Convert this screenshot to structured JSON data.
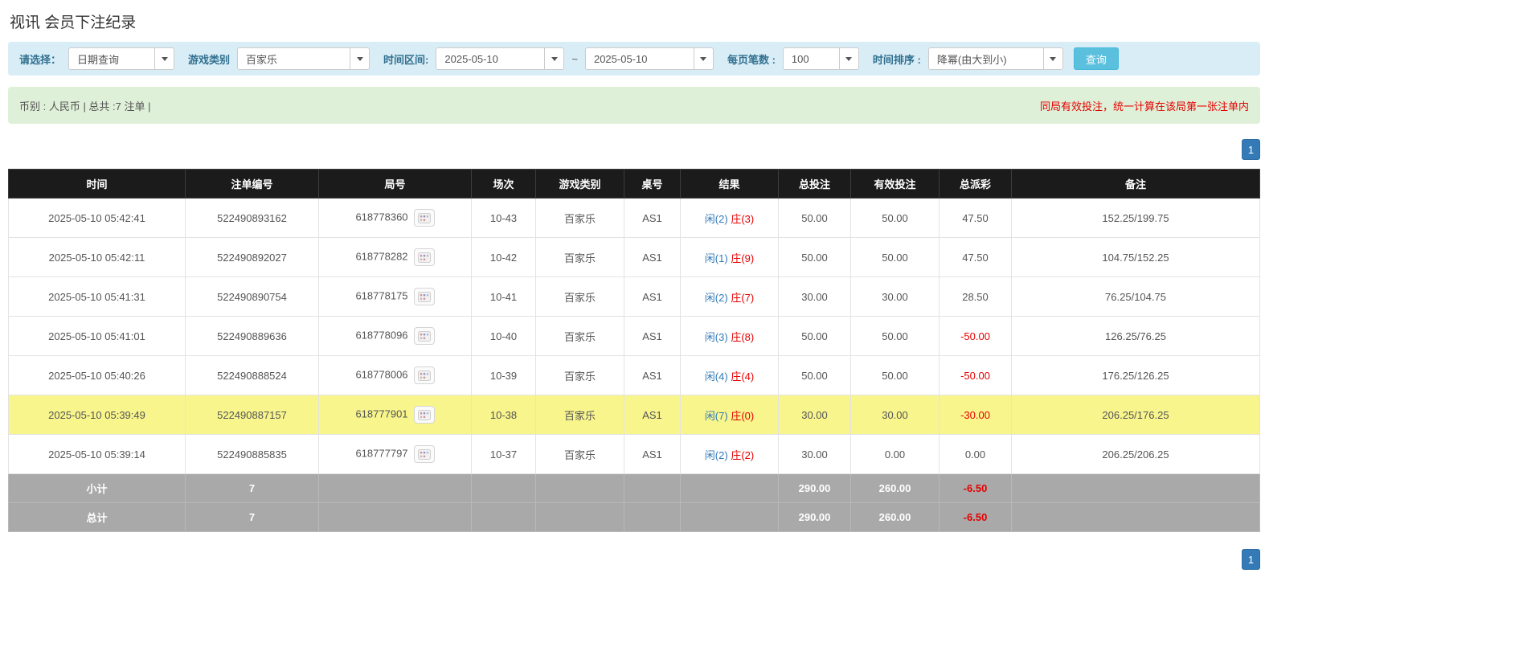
{
  "page": {
    "title": "视讯 会员下注纪录"
  },
  "filters": {
    "query_label": "请选择：",
    "query_value": "日期查询",
    "game_label": "游戏类别",
    "game_value": "百家乐",
    "range_label": "时间区间:",
    "date_from": "2025-05-10",
    "tilde": "~",
    "date_to": "2025-05-10",
    "page_size_label": "每页笔数 :",
    "page_size_value": "100",
    "sort_label": "时间排序 :",
    "sort_value": "降幂(由大到小)",
    "search_label": "查询"
  },
  "summary": {
    "left": "币别 : 人民币 | 总共 :7 注单 |",
    "notice": "同局有效投注，统一计算在该局第一张注单内"
  },
  "pagination": {
    "page": "1"
  },
  "table": {
    "columns": [
      "时间",
      "注单编号",
      "局号",
      "场次",
      "游戏类别",
      "桌号",
      "结果",
      "总投注",
      "有效投注",
      "总派彩",
      "备注"
    ],
    "rows": [
      {
        "time": "2025-05-10 05:42:41",
        "bet_no": "522490893162",
        "round_no": "618778360",
        "session": "10-43",
        "game": "百家乐",
        "table_no": "AS1",
        "player": "闲(2)",
        "banker": "庄(3)",
        "total_bet": "50.00",
        "valid_bet": "50.00",
        "payout": "47.50",
        "note": "152.25/199.75",
        "highlight": false
      },
      {
        "time": "2025-05-10 05:42:11",
        "bet_no": "522490892027",
        "round_no": "618778282",
        "session": "10-42",
        "game": "百家乐",
        "table_no": "AS1",
        "player": "闲(1)",
        "banker": "庄(9)",
        "total_bet": "50.00",
        "valid_bet": "50.00",
        "payout": "47.50",
        "note": "104.75/152.25",
        "highlight": false
      },
      {
        "time": "2025-05-10 05:41:31",
        "bet_no": "522490890754",
        "round_no": "618778175",
        "session": "10-41",
        "game": "百家乐",
        "table_no": "AS1",
        "player": "闲(2)",
        "banker": "庄(7)",
        "total_bet": "30.00",
        "valid_bet": "30.00",
        "payout": "28.50",
        "note": "76.25/104.75",
        "highlight": false
      },
      {
        "time": "2025-05-10 05:41:01",
        "bet_no": "522490889636",
        "round_no": "618778096",
        "session": "10-40",
        "game": "百家乐",
        "table_no": "AS1",
        "player": "闲(3)",
        "banker": "庄(8)",
        "total_bet": "50.00",
        "valid_bet": "50.00",
        "payout": "-50.00",
        "note": "126.25/76.25",
        "highlight": false
      },
      {
        "time": "2025-05-10 05:40:26",
        "bet_no": "522490888524",
        "round_no": "618778006",
        "session": "10-39",
        "game": "百家乐",
        "table_no": "AS1",
        "player": "闲(4)",
        "banker": "庄(4)",
        "total_bet": "50.00",
        "valid_bet": "50.00",
        "payout": "-50.00",
        "note": "176.25/126.25",
        "highlight": false
      },
      {
        "time": "2025-05-10 05:39:49",
        "bet_no": "522490887157",
        "round_no": "618777901",
        "session": "10-38",
        "game": "百家乐",
        "table_no": "AS1",
        "player": "闲(7)",
        "banker": "庄(0)",
        "total_bet": "30.00",
        "valid_bet": "30.00",
        "payout": "-30.00",
        "note": "206.25/176.25",
        "highlight": true
      },
      {
        "time": "2025-05-10 05:39:14",
        "bet_no": "522490885835",
        "round_no": "618777797",
        "session": "10-37",
        "game": "百家乐",
        "table_no": "AS1",
        "player": "闲(2)",
        "banker": "庄(2)",
        "total_bet": "30.00",
        "valid_bet": "0.00",
        "payout": "0.00",
        "note": "206.25/206.25",
        "highlight": false
      }
    ],
    "footers": [
      {
        "label": "小计",
        "count": "7",
        "total_bet": "290.00",
        "valid_bet": "260.00",
        "payout": "-6.50"
      },
      {
        "label": "总计",
        "count": "7",
        "total_bet": "290.00",
        "valid_bet": "260.00",
        "payout": "-6.50"
      }
    ]
  },
  "colors": {
    "accent_blue": "#337ab7",
    "negative_red": "#e60000",
    "highlight_yellow": "#f8f58d",
    "header_bg": "#1b1b1b",
    "footer_bg": "#a9a9a9",
    "filter_bg": "#d9edf7",
    "summary_bg": "#dff0d8",
    "button_blue": "#5bc0de"
  }
}
